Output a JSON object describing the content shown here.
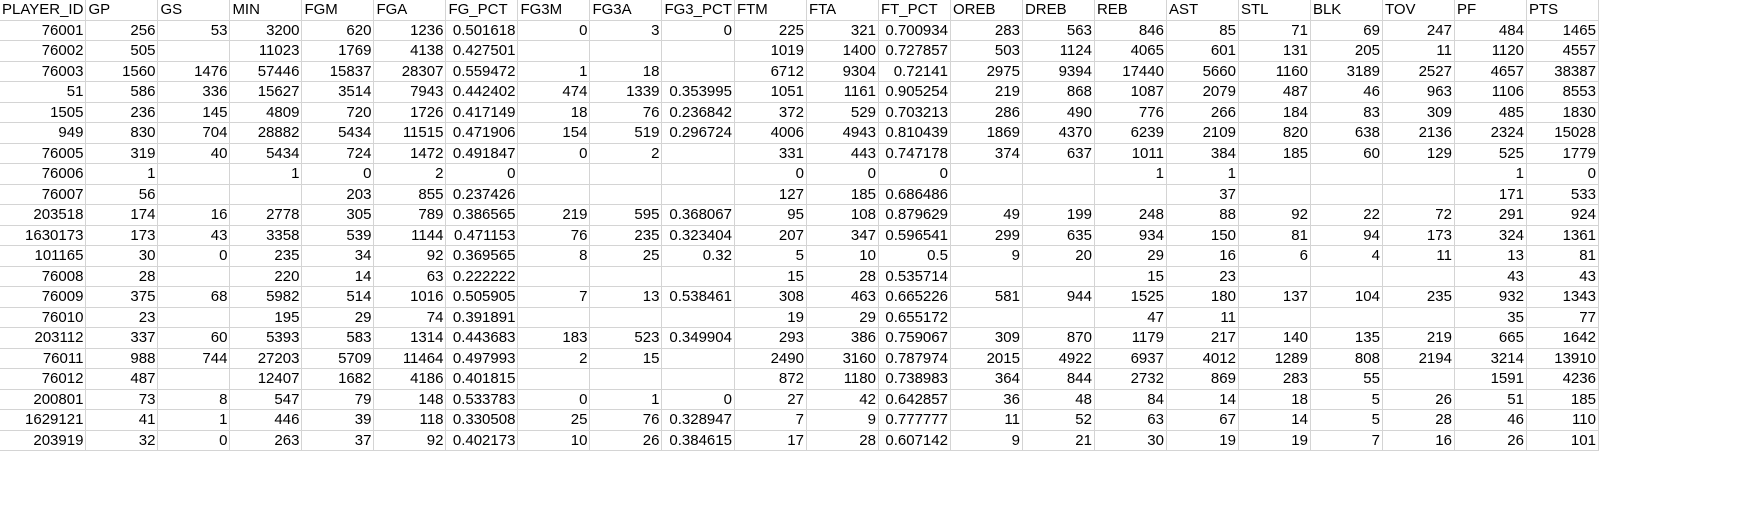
{
  "columns": [
    "PLAYER_ID",
    "GP",
    "GS",
    "MIN",
    "FGM",
    "FGA",
    "FG_PCT",
    "FG3M",
    "FG3A",
    "FG3_PCT",
    "FTM",
    "FTA",
    "FT_PCT",
    "OREB",
    "DREB",
    "REB",
    "AST",
    "STL",
    "BLK",
    "TOV",
    "PF",
    "PTS"
  ],
  "rows": [
    [
      "76001",
      "256",
      "53",
      "3200",
      "620",
      "1236",
      "0.501618",
      "0",
      "3",
      "0",
      "225",
      "321",
      "0.700934",
      "283",
      "563",
      "846",
      "85",
      "71",
      "69",
      "247",
      "484",
      "1465"
    ],
    [
      "76002",
      "505",
      "",
      "11023",
      "1769",
      "4138",
      "0.427501",
      "",
      "",
      "",
      "1019",
      "1400",
      "0.727857",
      "503",
      "1124",
      "4065",
      "601",
      "131",
      "205",
      "11",
      "1120",
      "4557"
    ],
    [
      "76003",
      "1560",
      "1476",
      "57446",
      "15837",
      "28307",
      "0.559472",
      "1",
      "18",
      "",
      "6712",
      "9304",
      "0.72141",
      "2975",
      "9394",
      "17440",
      "5660",
      "1160",
      "3189",
      "2527",
      "4657",
      "38387"
    ],
    [
      "51",
      "586",
      "336",
      "15627",
      "3514",
      "7943",
      "0.442402",
      "474",
      "1339",
      "0.353995",
      "1051",
      "1161",
      "0.905254",
      "219",
      "868",
      "1087",
      "2079",
      "487",
      "46",
      "963",
      "1106",
      "8553"
    ],
    [
      "1505",
      "236",
      "145",
      "4809",
      "720",
      "1726",
      "0.417149",
      "18",
      "76",
      "0.236842",
      "372",
      "529",
      "0.703213",
      "286",
      "490",
      "776",
      "266",
      "184",
      "83",
      "309",
      "485",
      "1830"
    ],
    [
      "949",
      "830",
      "704",
      "28882",
      "5434",
      "11515",
      "0.471906",
      "154",
      "519",
      "0.296724",
      "4006",
      "4943",
      "0.810439",
      "1869",
      "4370",
      "6239",
      "2109",
      "820",
      "638",
      "2136",
      "2324",
      "15028"
    ],
    [
      "76005",
      "319",
      "40",
      "5434",
      "724",
      "1472",
      "0.491847",
      "0",
      "2",
      "",
      "331",
      "443",
      "0.747178",
      "374",
      "637",
      "1011",
      "384",
      "185",
      "60",
      "129",
      "525",
      "1779"
    ],
    [
      "76006",
      "1",
      "",
      "1",
      "0",
      "2",
      "0",
      "",
      "",
      "",
      "0",
      "0",
      "0",
      "",
      "",
      "1",
      "1",
      "",
      "",
      "",
      "1",
      "0"
    ],
    [
      "76007",
      "56",
      "",
      "",
      "203",
      "855",
      "0.237426",
      "",
      "",
      "",
      "127",
      "185",
      "0.686486",
      "",
      "",
      "",
      "37",
      "",
      "",
      "",
      "171",
      "533"
    ],
    [
      "203518",
      "174",
      "16",
      "2778",
      "305",
      "789",
      "0.386565",
      "219",
      "595",
      "0.368067",
      "95",
      "108",
      "0.879629",
      "49",
      "199",
      "248",
      "88",
      "92",
      "22",
      "72",
      "291",
      "924"
    ],
    [
      "1630173",
      "173",
      "43",
      "3358",
      "539",
      "1144",
      "0.471153",
      "76",
      "235",
      "0.323404",
      "207",
      "347",
      "0.596541",
      "299",
      "635",
      "934",
      "150",
      "81",
      "94",
      "173",
      "324",
      "1361"
    ],
    [
      "101165",
      "30",
      "0",
      "235",
      "34",
      "92",
      "0.369565",
      "8",
      "25",
      "0.32",
      "5",
      "10",
      "0.5",
      "9",
      "20",
      "29",
      "16",
      "6",
      "4",
      "11",
      "13",
      "81"
    ],
    [
      "76008",
      "28",
      "",
      "220",
      "14",
      "63",
      "0.222222",
      "",
      "",
      "",
      "15",
      "28",
      "0.535714",
      "",
      "",
      "15",
      "23",
      "",
      "",
      "",
      "43",
      "43"
    ],
    [
      "76009",
      "375",
      "68",
      "5982",
      "514",
      "1016",
      "0.505905",
      "7",
      "13",
      "0.538461",
      "308",
      "463",
      "0.665226",
      "581",
      "944",
      "1525",
      "180",
      "137",
      "104",
      "235",
      "932",
      "1343"
    ],
    [
      "76010",
      "23",
      "",
      "195",
      "29",
      "74",
      "0.391891",
      "",
      "",
      "",
      "19",
      "29",
      "0.655172",
      "",
      "",
      "47",
      "11",
      "",
      "",
      "",
      "35",
      "77"
    ],
    [
      "203112",
      "337",
      "60",
      "5393",
      "583",
      "1314",
      "0.443683",
      "183",
      "523",
      "0.349904",
      "293",
      "386",
      "0.759067",
      "309",
      "870",
      "1179",
      "217",
      "140",
      "135",
      "219",
      "665",
      "1642"
    ],
    [
      "76011",
      "988",
      "744",
      "27203",
      "5709",
      "11464",
      "0.497993",
      "2",
      "15",
      "",
      "2490",
      "3160",
      "0.787974",
      "2015",
      "4922",
      "6937",
      "4012",
      "1289",
      "808",
      "2194",
      "3214",
      "13910"
    ],
    [
      "76012",
      "487",
      "",
      "12407",
      "1682",
      "4186",
      "0.401815",
      "",
      "",
      "",
      "872",
      "1180",
      "0.738983",
      "364",
      "844",
      "2732",
      "869",
      "283",
      "55",
      "",
      "1591",
      "4236"
    ],
    [
      "200801",
      "73",
      "8",
      "547",
      "79",
      "148",
      "0.533783",
      "0",
      "1",
      "0",
      "27",
      "42",
      "0.642857",
      "36",
      "48",
      "84",
      "14",
      "18",
      "5",
      "26",
      "51",
      "185"
    ],
    [
      "1629121",
      "41",
      "1",
      "446",
      "39",
      "118",
      "0.330508",
      "25",
      "76",
      "0.328947",
      "7",
      "9",
      "0.777777",
      "11",
      "52",
      "63",
      "67",
      "14",
      "5",
      "28",
      "46",
      "110"
    ],
    [
      "203919",
      "32",
      "0",
      "263",
      "37",
      "92",
      "0.402173",
      "10",
      "26",
      "0.384615",
      "17",
      "28",
      "0.607142",
      "9",
      "21",
      "30",
      "19",
      "19",
      "7",
      "16",
      "26",
      "101"
    ]
  ]
}
